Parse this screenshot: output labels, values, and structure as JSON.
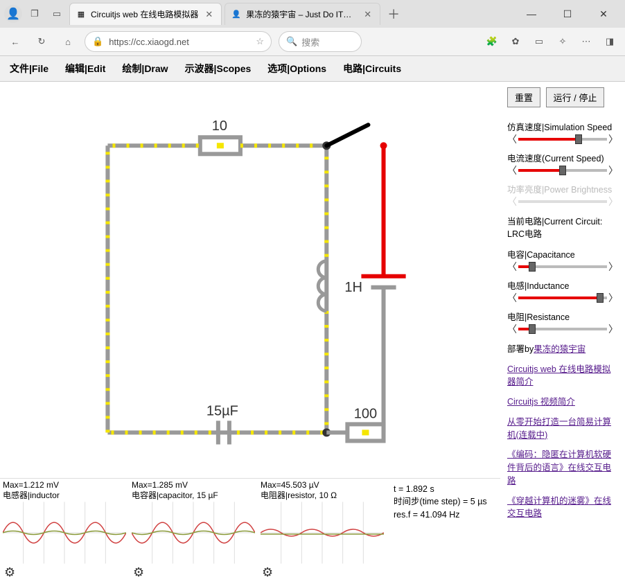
{
  "browser": {
    "tabs": [
      {
        "title": "Circuitjs web 在线电路模拟器",
        "favicon": "▦"
      },
      {
        "title": "果冻的猿宇宙 – Just Do IT，放胆",
        "favicon": "👤"
      }
    ],
    "url": "https://cc.xiaogd.net",
    "search_placeholder": "搜索",
    "win": {
      "min": "—",
      "max": "☐",
      "close": "✕"
    }
  },
  "menubar": [
    "文件|File",
    "编辑|Edit",
    "绘制|Draw",
    "示波器|Scopes",
    "选项|Options",
    "电路|Circuits"
  ],
  "sidebar": {
    "buttons": {
      "reset": "重置",
      "run": "运行 / 停止"
    },
    "sliders": [
      {
        "label": "仿真速度|Simulation Speed",
        "fill": 68,
        "disabled": false
      },
      {
        "label": "电流速度(Current Speed)",
        "fill": 50,
        "disabled": false
      },
      {
        "label": "功率亮度|Power Brightness",
        "fill": 50,
        "disabled": true
      }
    ],
    "current_circuit_label": "当前电路|Current Circuit:",
    "current_circuit_name": "LRC电路",
    "param_sliders": [
      {
        "label": "电容|Capacitance",
        "fill": 16
      },
      {
        "label": "电感|Inductance",
        "fill": 92
      },
      {
        "label": "电阻|Resistance",
        "fill": 16
      }
    ],
    "deploy_prefix": "部署by",
    "deploy_link": "果冻的猿宇宙",
    "links": [
      "Circuitjs web 在线电路模拟器简介",
      "Circuitjs 视频简介",
      "从零开始打造一台简易计算机(连载中)",
      "《编码：隐匿在计算机软硬件背后的语言》在线交互电路",
      "《穿越计算机的迷雾》在线交互电路"
    ]
  },
  "circuit": {
    "resistor_top_label": "10",
    "inductor_label": "1H",
    "capacitor_label": "15µF",
    "resistor_bottom_label": "100"
  },
  "scopes": [
    {
      "max": "Max=1.212 mV",
      "name": "电感器|inductor"
    },
    {
      "max": "Max=1.285 mV",
      "name": "电容器|capacitor, 15 µF"
    },
    {
      "max": "Max=45.503 µV",
      "name": "电阻器|resistor, 10 Ω"
    }
  ],
  "sim_info": {
    "t": "t = 1.892 s",
    "step": "时间步(time step) = 5 µs",
    "resf": "res.f = 41.094 Hz"
  }
}
